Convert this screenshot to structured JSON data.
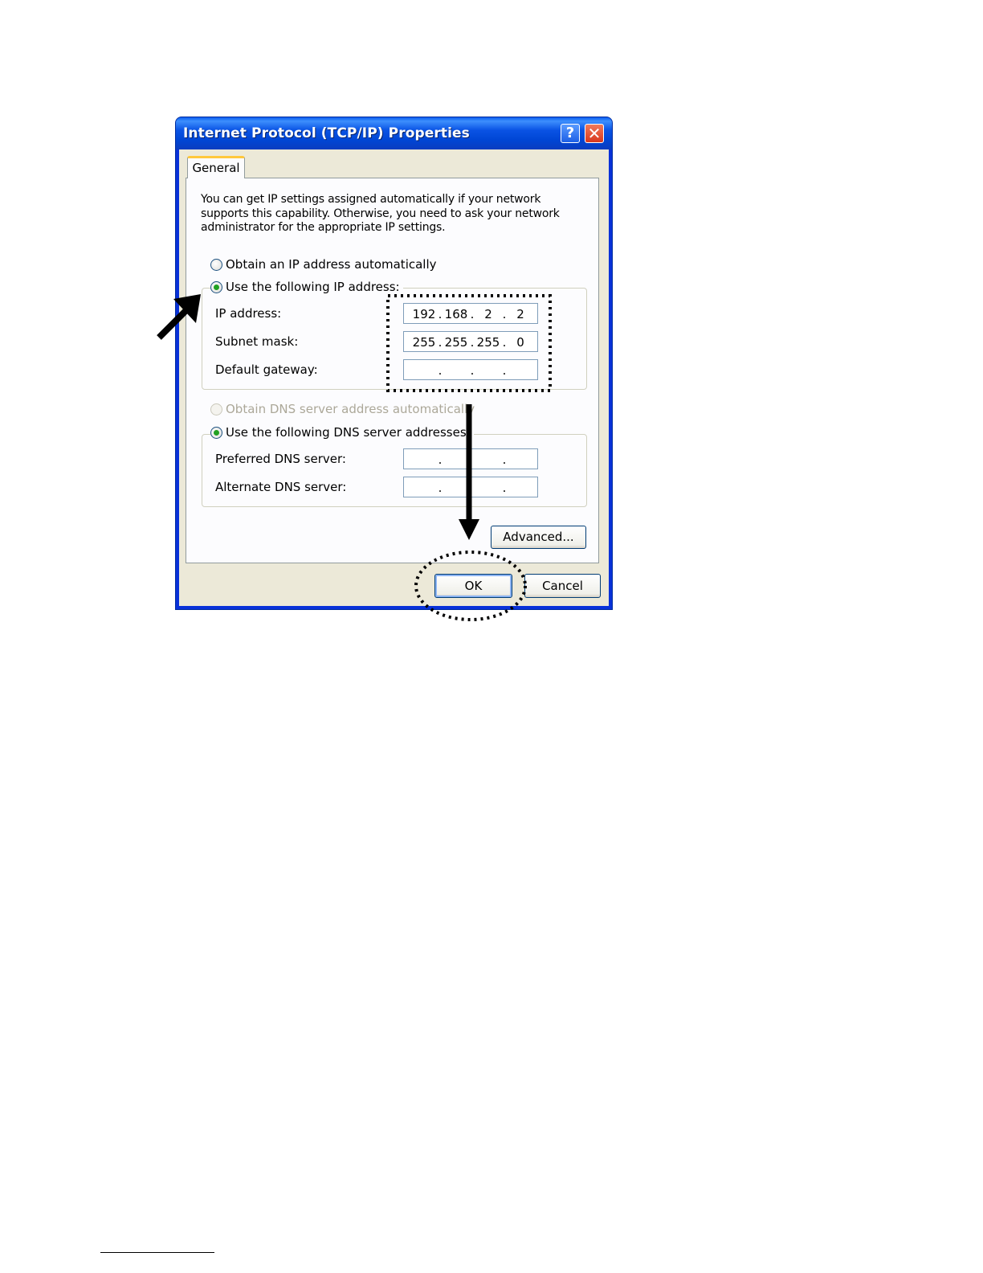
{
  "window": {
    "title": "Internet Protocol (TCP/IP) Properties",
    "help_glyph": "?",
    "close_glyph": "✕"
  },
  "tabs": [
    {
      "label": "General",
      "selected": true
    }
  ],
  "description": "You can get IP settings assigned automatically if your network supports this capability. Otherwise, you need to ask your network administrator for the appropriate IP settings.",
  "ip_section": {
    "auto_option": {
      "label": "Obtain an IP address automatically",
      "checked": false
    },
    "manual_option": {
      "label": "Use the following IP address:",
      "checked": true
    },
    "fields": [
      {
        "label": "IP address:",
        "octets": [
          "192",
          "168",
          "2",
          "2"
        ]
      },
      {
        "label": "Subnet mask:",
        "octets": [
          "255",
          "255",
          "255",
          "0"
        ]
      },
      {
        "label": "Default gateway:",
        "octets": [
          "",
          "",
          "",
          ""
        ]
      }
    ]
  },
  "dns_section": {
    "auto_option": {
      "label": "Obtain DNS server address automatically",
      "checked": false,
      "disabled": true
    },
    "manual_option": {
      "label": "Use the following DNS server addresses:",
      "checked": true
    },
    "fields": [
      {
        "label": "Preferred DNS server:",
        "octets": [
          "",
          "",
          "",
          ""
        ]
      },
      {
        "label": "Alternate DNS server:",
        "octets": [
          "",
          "",
          "",
          ""
        ]
      }
    ]
  },
  "buttons": {
    "advanced": "Advanced...",
    "ok": "OK",
    "cancel": "Cancel"
  },
  "colors": {
    "titlebar": "#0a53e4",
    "dialog_bg": "#ece9d8",
    "tab_highlight": "#ffc83c",
    "radio_dot": "#21a121",
    "annotation": "#000000"
  }
}
